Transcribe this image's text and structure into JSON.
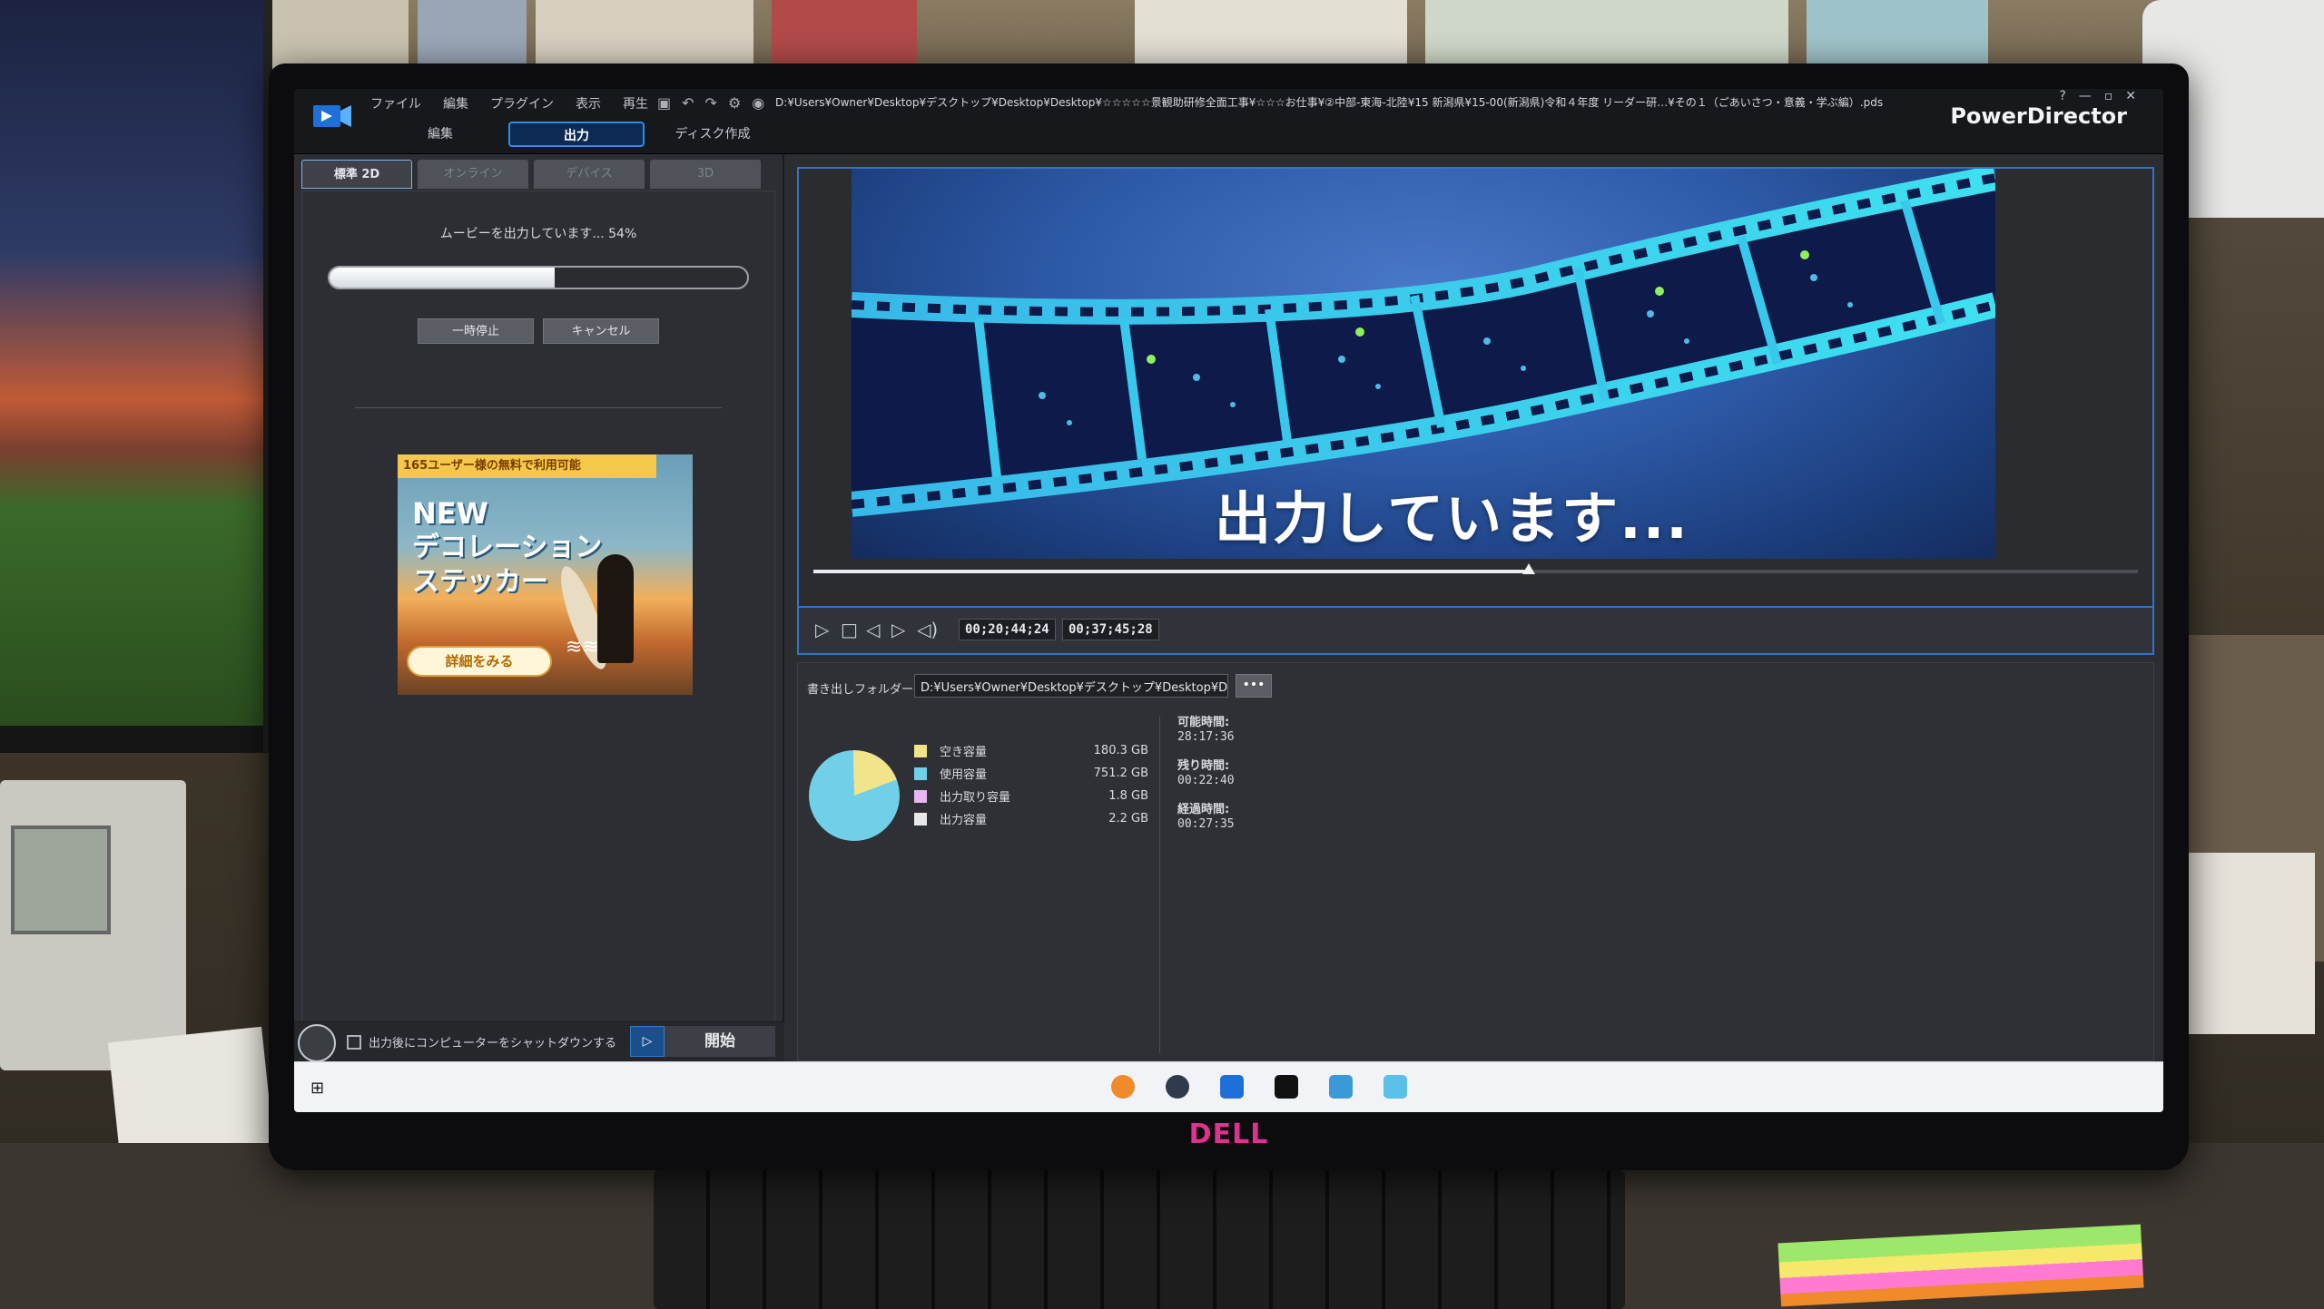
{
  "app": {
    "brand": "PowerDirector",
    "menu": [
      "ファイル",
      "編集",
      "プラグイン",
      "表示",
      "再生"
    ],
    "file_path": "D:¥Users¥Owner¥Desktop¥デスクトップ¥Desktop¥Desktop¥☆☆☆☆☆景観助研修全面工事¥☆☆☆お仕事¥②中部-東海-北陸¥15 新潟県¥15-00(新潟県)令和４年度 リーダー研…¥その１（ごあいさつ・意義・学ぶ編）.pds",
    "modes": [
      {
        "label": "編集",
        "active": false
      },
      {
        "label": "出力",
        "active": true
      },
      {
        "label": "ディスク作成",
        "active": false
      }
    ],
    "window_controls": [
      "?",
      "—",
      "▫",
      "✕"
    ]
  },
  "left_panel": {
    "sub_tabs": [
      {
        "label": "標準 2D",
        "active": true
      },
      {
        "label": "オンライン",
        "active": false
      },
      {
        "label": "デバイス",
        "active": false
      },
      {
        "label": "3D",
        "active": false
      }
    ],
    "progress_text": "ムービーを出力しています... 54%",
    "progress_fraction": 0.54,
    "pause_label": "一時停止",
    "cancel_label": "キャンセル",
    "ad": {
      "banner": "165ユーザー様の無料で利用可能",
      "new_label": "NEW",
      "title_line1": "デコレーション",
      "title_line2": "ステッカー",
      "cta": "詳細をみる"
    },
    "shutdown_label": "出力後にコンピューターをシャットダウンする",
    "start_label": "開始"
  },
  "preview": {
    "caption": "出力しています...",
    "scrub_fraction": 0.54,
    "timecode_current": "00;20;44;24",
    "timecode_total": "00;37;45;28"
  },
  "output": {
    "folder_label": "書き出しフォルダー:",
    "folder_path": "D:¥Users¥Owner¥Desktop¥デスクトップ¥Desktop¥Desktop",
    "browse_label": "•••",
    "disk": [
      {
        "name": "空き容量",
        "value": "180.3 GB",
        "color": "#f2e48a"
      },
      {
        "name": "使用容量",
        "value": "751.2 GB",
        "color": "#6fd0e8"
      },
      {
        "name": "出力取り容量",
        "value": "1.8 GB",
        "color": "#e8b6f0"
      },
      {
        "name": "出力容量",
        "value": "2.2 GB",
        "color": "#e8e8e8"
      }
    ],
    "times": [
      {
        "label": "可能時間:",
        "value": "28:17:36"
      },
      {
        "label": "残り時間:",
        "value": "00:22:40"
      },
      {
        "label": "経過時間:",
        "value": "00:27:35"
      }
    ]
  },
  "monitor_brand": "DELL",
  "icons": {
    "play": "play-icon",
    "stop": "stop-icon",
    "prev": "prev-frame-icon",
    "next": "next-frame-icon",
    "volume": "volume-icon",
    "windows": "windows-start-icon"
  }
}
